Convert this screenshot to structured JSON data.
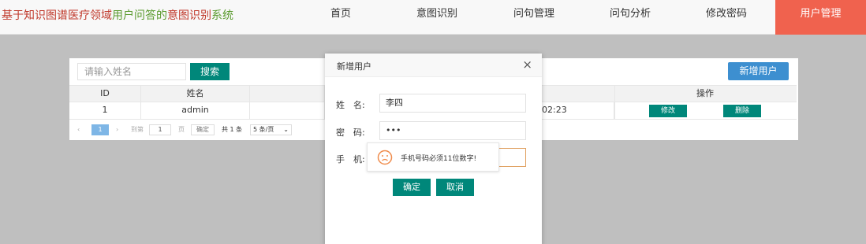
{
  "header": {
    "title_parts": [
      "基于知识图谱医疗领域",
      "用户问答的",
      "意图识别",
      "系统"
    ],
    "nav": [
      "首页",
      "意图识别",
      "问句管理",
      "问句分析",
      "修改密码",
      "用户管理"
    ],
    "active_nav": "用户管理"
  },
  "search": {
    "placeholder": "请输入姓名",
    "button": "搜索"
  },
  "add_user_button": "新增用户",
  "table": {
    "headers": [
      "ID",
      "姓名",
      "操作"
    ],
    "rows": [
      {
        "id": "1",
        "name": "admin",
        "time": "02:23",
        "edit": "修改",
        "delete": "删除"
      }
    ]
  },
  "pager": {
    "current_page": "1",
    "goto_label": "到第",
    "goto_value": "1",
    "page_unit": "页",
    "confirm": "确定",
    "total": "共 1 条",
    "page_size": "5 条/页"
  },
  "modal": {
    "title": "新增用户",
    "close": "×",
    "name_label": "姓　名:",
    "name_value": "李四",
    "password_label": "密　码:",
    "password_value": "•••",
    "phone_label": "手　机:",
    "phone_value": "",
    "ok": "确定",
    "cancel": "取消"
  },
  "tooltip": {
    "message": "手机号码必须11位数字!",
    "icon": "sad-face-icon"
  },
  "colors": {
    "teal": "#00877a",
    "blue": "#3d8fd0",
    "active_nav": "#f0624e",
    "warning": "#f08c4c"
  }
}
